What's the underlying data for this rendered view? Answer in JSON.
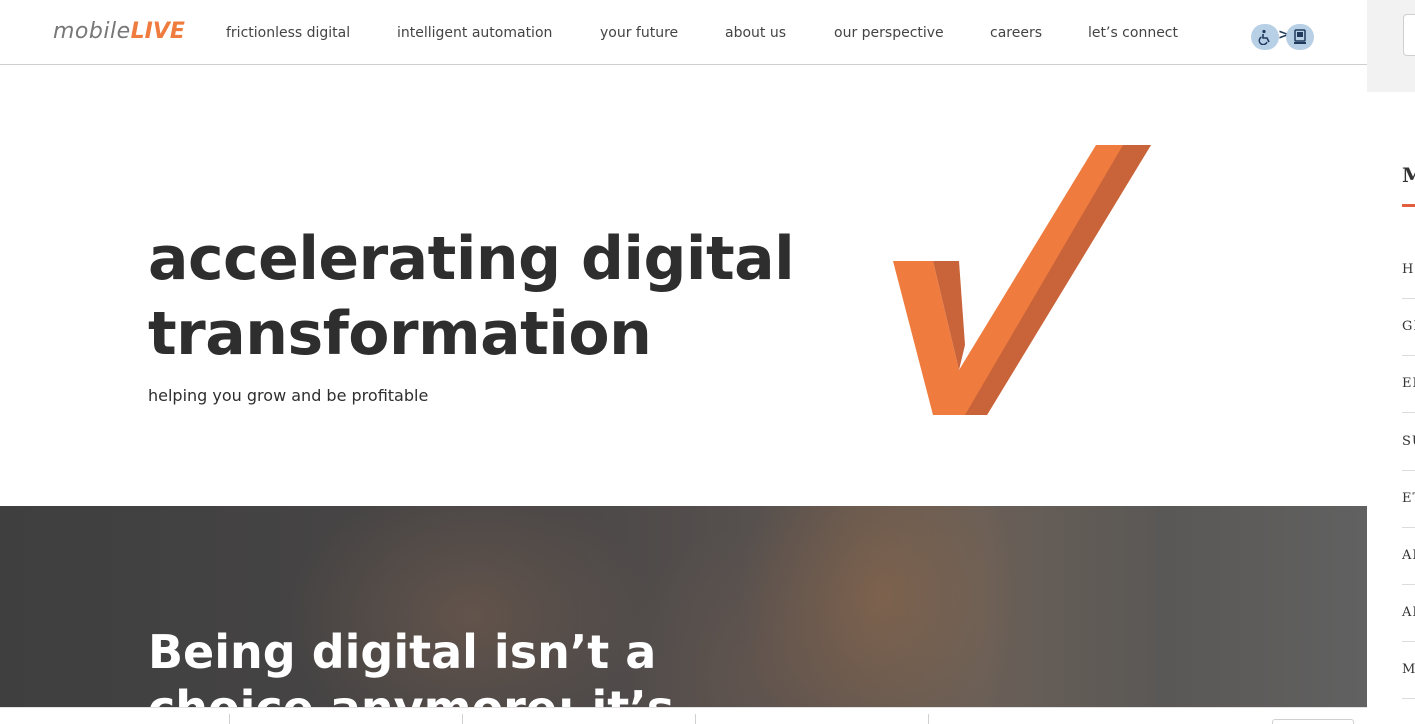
{
  "header": {
    "logo_text_1": "mobile",
    "logo_text_2": "LIVE",
    "nav": [
      {
        "label": "frictionless digital"
      },
      {
        "label": "intelligent automation"
      },
      {
        "label": "your future"
      },
      {
        "label": "about us"
      },
      {
        "label": "our perspective"
      },
      {
        "label": "careers"
      },
      {
        "label": "let’s connect"
      }
    ],
    "accessibility": {
      "left_icon": "wheelchair-icon",
      "separator": ">",
      "right_icon": "computer-icon"
    }
  },
  "hero": {
    "title_line_1": "accelerating digital",
    "title_line_2": "transformation",
    "subtitle": "helping you grow and be profitable",
    "graphic": "orange-checkmark-icon"
  },
  "band": {
    "title_line_1": "Being digital isn’t a",
    "title_line_2": "choice anymore: it’s"
  },
  "side_panel": {
    "heading": "M",
    "items": [
      {
        "label": "HO"
      },
      {
        "label": "GR"
      },
      {
        "label": "EN"
      },
      {
        "label": "SU"
      },
      {
        "label": "ET"
      },
      {
        "label": "AR"
      },
      {
        "label": "AR"
      },
      {
        "label": "MI"
      }
    ]
  },
  "colors": {
    "brand_orange": "#ef7c3e",
    "brand_orange_dark": "#c9633a",
    "text_dark": "#2e2e2e",
    "accent_red": "#e35d3f"
  }
}
